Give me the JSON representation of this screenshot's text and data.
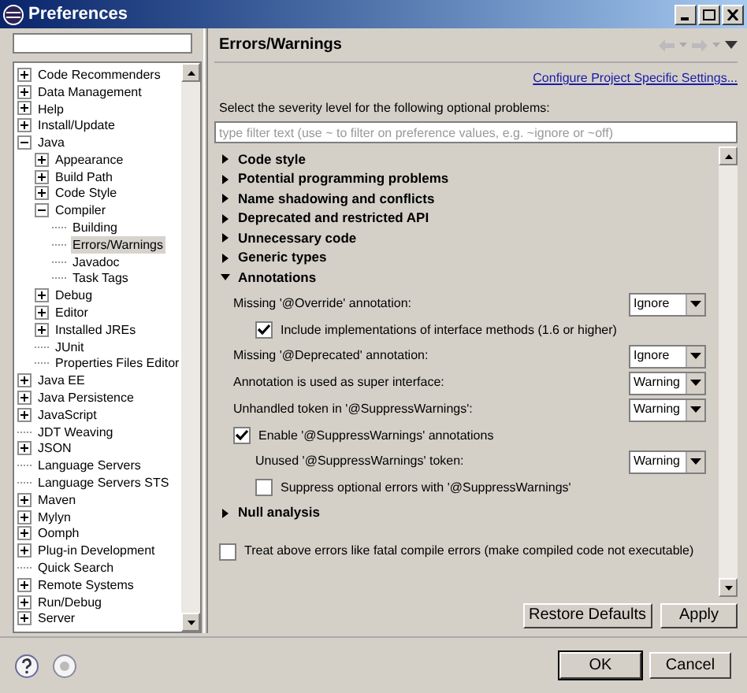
{
  "window": {
    "title": "Preferences"
  },
  "tree": [
    {
      "label": "Code Recommenders",
      "kind": "folder",
      "expanded": false,
      "selected": false
    },
    {
      "label": "Data Management",
      "kind": "folder",
      "expanded": false,
      "selected": false
    },
    {
      "label": "Help",
      "kind": "folder",
      "expanded": false,
      "selected": false
    },
    {
      "label": "Install/Update",
      "kind": "folder",
      "expanded": false,
      "selected": false
    },
    {
      "label": "Java",
      "kind": "folder",
      "expanded": true,
      "selected": false,
      "children": [
        {
          "label": "Appearance",
          "kind": "folder",
          "expanded": false,
          "selected": false
        },
        {
          "label": "Build Path",
          "kind": "folder",
          "expanded": false,
          "selected": false
        },
        {
          "label": "Code Style",
          "kind": "folder",
          "expanded": false,
          "selected": false
        },
        {
          "label": "Compiler",
          "kind": "folder",
          "expanded": true,
          "selected": false,
          "children": [
            {
              "label": "Building",
              "kind": "leaf",
              "selected": false
            },
            {
              "label": "Errors/Warnings",
              "kind": "leaf",
              "selected": true
            },
            {
              "label": "Javadoc",
              "kind": "leaf",
              "selected": false
            },
            {
              "label": "Task Tags",
              "kind": "leaf",
              "selected": false
            }
          ]
        },
        {
          "label": "Debug",
          "kind": "folder",
          "expanded": false,
          "selected": false
        },
        {
          "label": "Editor",
          "kind": "folder",
          "expanded": false,
          "selected": false
        },
        {
          "label": "Installed JREs",
          "kind": "folder",
          "expanded": false,
          "selected": false
        },
        {
          "label": "JUnit",
          "kind": "leaf",
          "selected": false
        },
        {
          "label": "Properties Files Editor",
          "kind": "leaf",
          "selected": false
        }
      ]
    },
    {
      "label": "Java EE",
      "kind": "folder",
      "expanded": false,
      "selected": false
    },
    {
      "label": "Java Persistence",
      "kind": "folder",
      "expanded": false,
      "selected": false
    },
    {
      "label": "JavaScript",
      "kind": "folder",
      "expanded": false,
      "selected": false
    },
    {
      "label": "JDT Weaving",
      "kind": "leaf",
      "selected": false
    },
    {
      "label": "JSON",
      "kind": "folder",
      "expanded": false,
      "selected": false
    },
    {
      "label": "Language Servers",
      "kind": "leaf",
      "selected": false
    },
    {
      "label": "Language Servers STS",
      "kind": "leaf",
      "selected": false
    },
    {
      "label": "Maven",
      "kind": "folder",
      "expanded": false,
      "selected": false
    },
    {
      "label": "Mylyn",
      "kind": "folder",
      "expanded": false,
      "selected": false
    },
    {
      "label": "Oomph",
      "kind": "folder",
      "expanded": false,
      "selected": false
    },
    {
      "label": "Plug-in Development",
      "kind": "folder",
      "expanded": false,
      "selected": false
    },
    {
      "label": "Quick Search",
      "kind": "leaf",
      "selected": false
    },
    {
      "label": "Remote Systems",
      "kind": "folder",
      "expanded": false,
      "selected": false
    },
    {
      "label": "Run/Debug",
      "kind": "folder",
      "expanded": false,
      "selected": false
    },
    {
      "label": "Server",
      "kind": "folder",
      "expanded": false,
      "selected": false
    }
  ],
  "page": {
    "title": "Errors/Warnings",
    "link": "Configure Project Specific Settings...",
    "description": "Select the severity level for the following optional problems:",
    "filter": {
      "placeholder": "type filter text (use ~ to filter on preference values, e.g. ~ignore or ~off)"
    },
    "sections": [
      {
        "label": "Code style",
        "expanded": false
      },
      {
        "label": "Potential programming problems",
        "expanded": false
      },
      {
        "label": "Name shadowing and conflicts",
        "expanded": false
      },
      {
        "label": "Deprecated and restricted API",
        "expanded": false
      },
      {
        "label": "Unnecessary code",
        "expanded": false
      },
      {
        "label": "Generic types",
        "expanded": false
      },
      {
        "label": "Annotations",
        "expanded": true,
        "options": [
          {
            "kind": "combo",
            "label": "Missing '@Override' annotation:",
            "value": "Ignore",
            "children": [
              {
                "kind": "check",
                "label": "Include implementations of interface methods (1.6 or higher)",
                "checked": true
              }
            ]
          },
          {
            "kind": "combo",
            "label": "Missing '@Deprecated' annotation:",
            "value": "Ignore"
          },
          {
            "kind": "combo",
            "label": "Annotation is used as super interface:",
            "value": "Warning"
          },
          {
            "kind": "combo",
            "label": "Unhandled token in '@SuppressWarnings':",
            "value": "Warning"
          },
          {
            "kind": "check",
            "label": "Enable '@SuppressWarnings' annotations",
            "checked": true,
            "children": [
              {
                "kind": "combo",
                "label": "Unused '@SuppressWarnings' token:",
                "value": "Warning"
              },
              {
                "kind": "check",
                "label": "Suppress optional errors with '@SuppressWarnings'",
                "checked": false
              }
            ]
          }
        ]
      },
      {
        "label": "Null analysis",
        "expanded": false
      }
    ],
    "fatal": {
      "label": "Treat above errors like fatal compile errors (make compiled code not executable)",
      "checked": false
    },
    "buttons": [
      "Restore Defaults",
      "Apply"
    ]
  },
  "dialog_buttons": [
    "OK",
    "Cancel"
  ]
}
